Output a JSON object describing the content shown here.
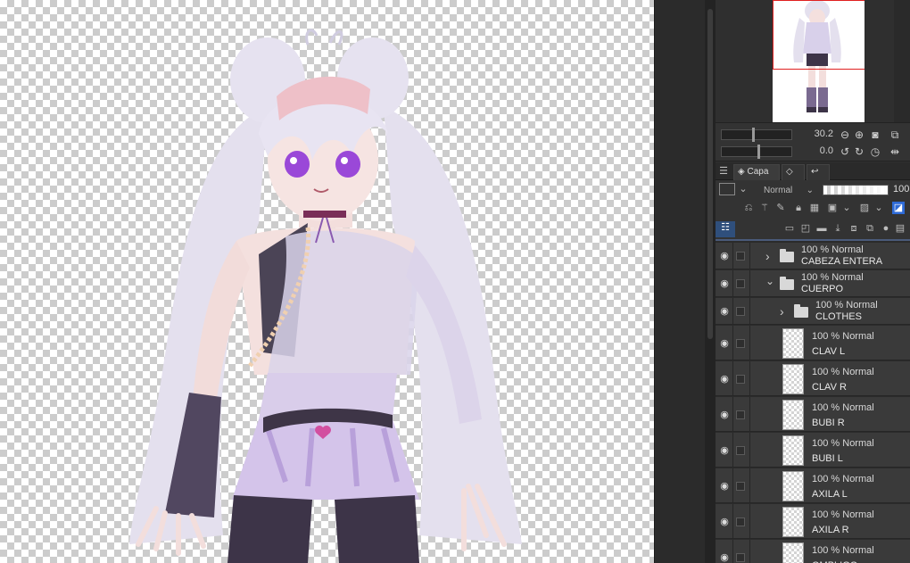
{
  "canvas": {
    "subject": "anime character illustration",
    "colors": {
      "hair": "#e2deec",
      "skin": "#f6e2e0",
      "dress": "#d8c8ec",
      "dark": "#4a3f55",
      "accent": "#b57cd6"
    }
  },
  "navigator": {
    "zoom_value": "30.2",
    "rotation_value": "0.0"
  },
  "tabs": {
    "layer_tab_label": "Capa"
  },
  "layer_toolbar": {
    "blend_mode": "Normal",
    "opacity_value": "100",
    "opacity_fraction": 1.0
  },
  "layers": [
    {
      "type": "folder",
      "depth": 0,
      "expanded": false,
      "props": "100 % Normal",
      "name": "CABEZA ENTERA"
    },
    {
      "type": "folder",
      "depth": 0,
      "expanded": true,
      "props": "100 % Normal",
      "name": "CUERPO"
    },
    {
      "type": "folder",
      "depth": 1,
      "expanded": false,
      "props": "100 % Normal",
      "name": "CLOTHES"
    },
    {
      "type": "layer",
      "depth": 1,
      "props": "100 % Normal",
      "name": "CLAV L"
    },
    {
      "type": "layer",
      "depth": 1,
      "props": "100 % Normal",
      "name": "CLAV R"
    },
    {
      "type": "layer",
      "depth": 1,
      "props": "100 % Normal",
      "name": "BUBI R"
    },
    {
      "type": "layer",
      "depth": 1,
      "props": "100 % Normal",
      "name": "BUBI L"
    },
    {
      "type": "layer",
      "depth": 1,
      "props": "100 % Normal",
      "name": "AXILA L"
    },
    {
      "type": "layer",
      "depth": 1,
      "props": "100 % Normal",
      "name": "AXILA R"
    },
    {
      "type": "layer",
      "depth": 1,
      "props": "100 % Normal",
      "name": "OMBLIGO"
    }
  ]
}
